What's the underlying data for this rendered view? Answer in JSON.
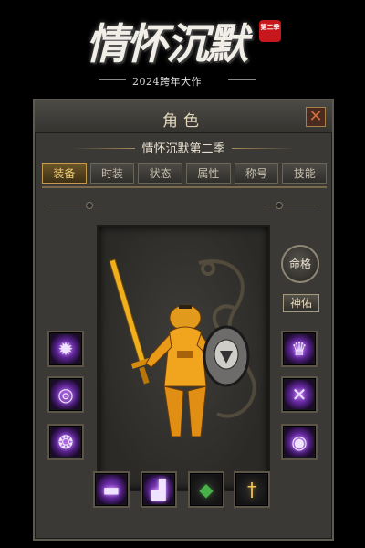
{
  "logo": {
    "title": "情怀沉默",
    "season": "第二季",
    "subtitle": "2024跨年大作"
  },
  "window": {
    "title": "角色",
    "close_glyph": "✕",
    "character_name": "情怀沉默第二季"
  },
  "tabs": [
    {
      "label": "装备",
      "active": true
    },
    {
      "label": "时装",
      "active": false
    },
    {
      "label": "状态",
      "active": false
    },
    {
      "label": "属性",
      "active": false
    },
    {
      "label": "称号",
      "active": false
    },
    {
      "label": "技能",
      "active": false
    }
  ],
  "buttons": {
    "fate": "命格",
    "blessing": "神佑"
  },
  "equipment": {
    "left": [
      {
        "icon": "flower-emblem-icon",
        "glyph": "✹"
      },
      {
        "icon": "necklace-icon",
        "glyph": "◎"
      },
      {
        "icon": "bracelet-icon",
        "glyph": "❂"
      }
    ],
    "right": [
      {
        "icon": "helmet-icon",
        "glyph": "♛"
      },
      {
        "icon": "crossed-blades-icon",
        "glyph": "✕"
      },
      {
        "icon": "ring-icon",
        "glyph": "◉"
      }
    ],
    "bottom": [
      {
        "icon": "belt-icon",
        "glyph": "▬"
      },
      {
        "icon": "boots-icon",
        "glyph": "▟"
      },
      {
        "icon": "green-gem-icon",
        "glyph": "◆"
      },
      {
        "icon": "dagger-icon",
        "glyph": "†"
      }
    ]
  },
  "colors": {
    "accent_gold": "#f6d27a",
    "slot_purple": "#9b4fd8",
    "panel_bg": "#3a3936",
    "close_red": "#d46d3d"
  }
}
